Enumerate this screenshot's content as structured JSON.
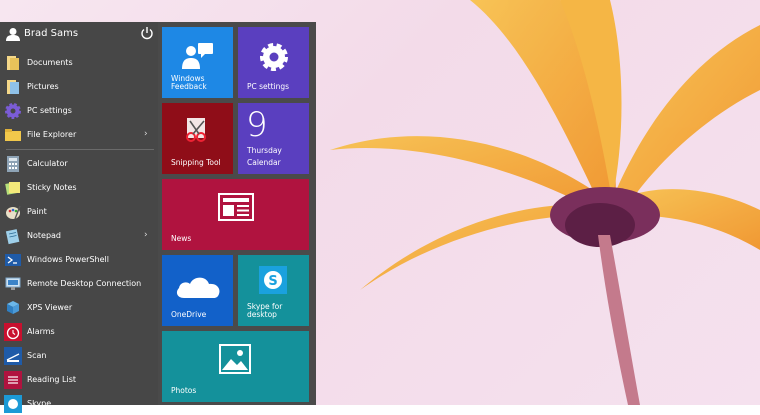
{
  "user": {
    "name": "Brad Sams"
  },
  "places": [
    {
      "label": "Documents",
      "icon": "folder-documents-icon"
    },
    {
      "label": "Pictures",
      "icon": "folder-pictures-icon"
    },
    {
      "label": "PC settings",
      "icon": "gear-icon"
    },
    {
      "label": "File Explorer",
      "icon": "file-explorer-icon",
      "chevron": "›"
    }
  ],
  "apps": [
    {
      "label": "Calculator",
      "icon": "calculator-icon"
    },
    {
      "label": "Sticky Notes",
      "icon": "sticky-notes-icon"
    },
    {
      "label": "Paint",
      "icon": "paint-icon"
    },
    {
      "label": "Notepad",
      "icon": "notepad-icon",
      "chevron": "›"
    },
    {
      "label": "Windows PowerShell",
      "icon": "powershell-icon"
    },
    {
      "label": "Remote Desktop Connection",
      "icon": "remote-desktop-icon"
    },
    {
      "label": "XPS Viewer",
      "icon": "xps-viewer-icon"
    },
    {
      "label": "Alarms",
      "icon": "alarm-clock-icon"
    },
    {
      "label": "Scan",
      "icon": "scan-icon"
    },
    {
      "label": "Reading List",
      "icon": "reading-list-icon"
    },
    {
      "label": "Skype",
      "icon": "skype-icon"
    }
  ],
  "tiles": {
    "feedback": {
      "label_line1": "Windows",
      "label_line2": "Feedback",
      "color": "#1e88e5"
    },
    "pc_settings": {
      "label": "PC settings",
      "color": "#5a3fbf"
    },
    "snipping": {
      "label": "Snipping Tool",
      "color": "#8f0d18"
    },
    "calendar": {
      "day_number": "9",
      "weekday": "Thursday",
      "label": "Calendar",
      "color": "#5a3fbf"
    },
    "news": {
      "label": "News",
      "color": "#b0133f"
    },
    "onedrive": {
      "label": "OneDrive",
      "color": "#1261c9"
    },
    "skype": {
      "label_line1": "Skype for",
      "label_line2": "desktop",
      "color": "#14919b"
    },
    "photos": {
      "label": "Photos",
      "color": "#14919b"
    }
  }
}
